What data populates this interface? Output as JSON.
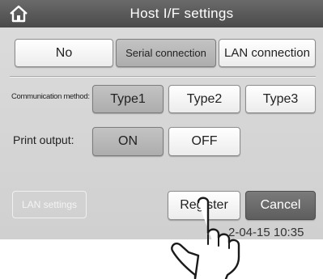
{
  "header": {
    "title": "Host I/F settings",
    "home_icon": "home-icon"
  },
  "connection": {
    "options": [
      "No",
      "Serial connection",
      "LAN connection"
    ],
    "selected": "Serial connection"
  },
  "communication_method": {
    "label": "Communication method:",
    "options": [
      "Type1",
      "Type2",
      "Type3"
    ],
    "selected": "Type1"
  },
  "print_output": {
    "label": "Print output:",
    "options": [
      "ON",
      "OFF"
    ],
    "selected": "ON"
  },
  "footer": {
    "lan_settings_label": "LAN settings",
    "register_label": "Register",
    "cancel_label": "Cancel",
    "datetime": "2-04-15 10:35"
  },
  "colors": {
    "title_bar": "#555555",
    "screen_bg": "#d6d6d6",
    "selected_button": "#b8b8b8",
    "cancel_button": "#6a6a6a"
  },
  "overlay": {
    "hand_icon": "pointing-hand-icon"
  }
}
